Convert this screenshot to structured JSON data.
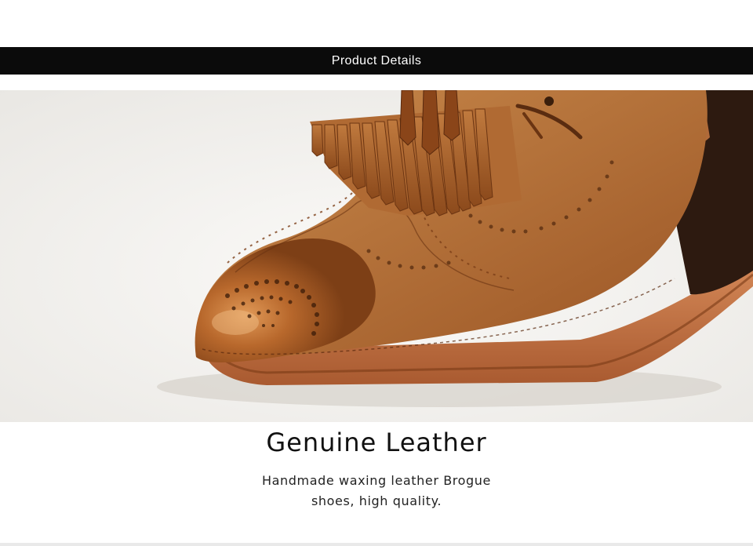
{
  "header": {
    "title": "Product Details"
  },
  "image": {
    "subject": "brogue-tassel-shoe-icon"
  },
  "caption": {
    "title": "Genuine Leather",
    "line1": "Handmade waxing leather Brogue",
    "line2": "shoes, high quality."
  },
  "colors": {
    "bar": "#0b0b0b",
    "leather": "#b0652a",
    "sole": "#c87445",
    "background": "#ffffff"
  }
}
